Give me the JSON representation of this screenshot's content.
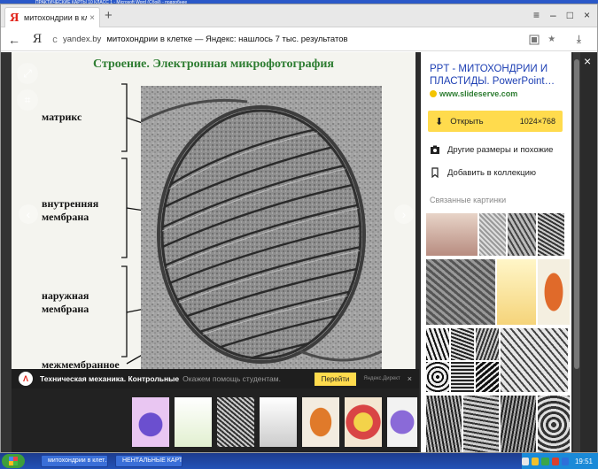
{
  "background_strip": {
    "text": "ПРАКТИЧЕСКИЕ КАРТЫ 10 КЛАСС 1 - Microsoft Word (Сбой) - подробнее"
  },
  "browser": {
    "tab": {
      "title": "митохондрии в клетке —",
      "close": "×"
    },
    "new_tab": "+",
    "window_controls": {
      "menu": "≡",
      "minimize": "–",
      "maximize": "□",
      "close": "×"
    },
    "address": {
      "back": "←",
      "yandex_btn": "Я",
      "reload": "c",
      "domain": "yandex.by",
      "title": "митохондрии в клетке — Яндекс: нашлось 7 тыс. результатов",
      "download": "⤓"
    }
  },
  "viewer": {
    "close": "×",
    "slide": {
      "title": "Строение. Электронная микрофотография",
      "labels": {
        "matrix": "матрикс",
        "inner": "внутренняя\nмембрана",
        "outer": "наружная\nмембрана",
        "intermembrane": "межмембранное"
      }
    },
    "panel": {
      "title": "PPT - МИТОХОНДРИИ И ПЛАСТИДЫ. PowerPoint…",
      "source": "www.slideserve.com",
      "open_label": "Открыть",
      "dimensions": "1024×768",
      "other_sizes": "Другие размеры и похожие",
      "add_collection": "Добавить в коллекцию",
      "related": "Связанные картинки"
    },
    "ad": {
      "logo": "Λ",
      "title": "Техническая механика. Контрольные",
      "subtitle": "Окажем помощь студентам.",
      "button": "Перейти",
      "direct": "Яндекс.Директ",
      "close": "×"
    }
  },
  "taskbar": {
    "tasks": [
      {
        "label": "митохондрии в клет…",
        "color": "#e2231a"
      },
      {
        "label": "НЕНТАЛЬНЫЕ КАРТЫ…",
        "color": "#2b5bd7"
      }
    ],
    "clock": "19:51"
  },
  "colors": {
    "accent_yellow": "#ffdb4d",
    "link_blue": "#1e40b4",
    "source_green": "#2e7d32",
    "yandex_red": "#e2231a"
  }
}
